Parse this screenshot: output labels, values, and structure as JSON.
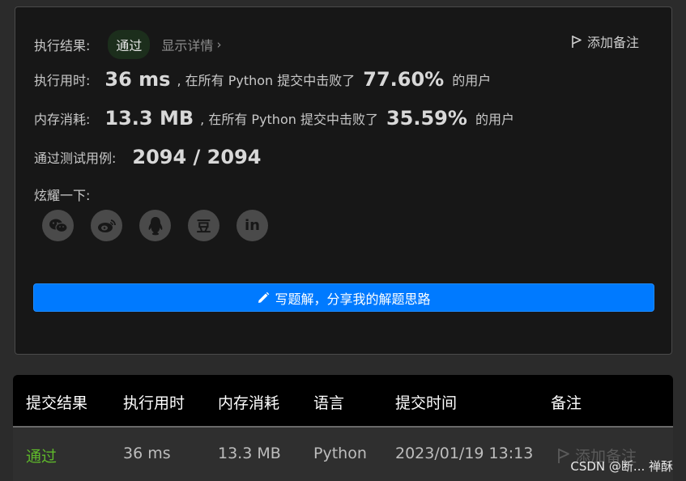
{
  "result": {
    "label": "执行结果:",
    "status": "通过",
    "details_link": "显示详情",
    "details_chevron": "›",
    "add_note": "添加备注"
  },
  "runtime": {
    "label": "执行用时:",
    "value": "36 ms",
    "middle": ", 在所有 Python 提交中击败了",
    "percent": "77.60%",
    "suffix": "的用户"
  },
  "memory": {
    "label": "内存消耗:",
    "value": "13.3 MB",
    "middle": ", 在所有 Python 提交中击败了",
    "percent": "35.59%",
    "suffix": "的用户"
  },
  "tests": {
    "label": "通过测试用例:",
    "value": "2094 / 2094"
  },
  "share": {
    "label": "炫耀一下:",
    "icons": [
      "wechat-icon",
      "weibo-icon",
      "qq-icon",
      "douban-icon",
      "linkedin-icon"
    ],
    "douban_glyph": "豆",
    "linkedin_glyph": "in"
  },
  "write_button": "写题解，分享我的解题思路",
  "table": {
    "headers": [
      "提交结果",
      "执行用时",
      "内存消耗",
      "语言",
      "提交时间",
      "备注"
    ],
    "row": {
      "result": "通过",
      "runtime": "36 ms",
      "memory": "13.3 MB",
      "language": "Python",
      "time": "2023/01/19 13:13",
      "note": "添加备注"
    }
  },
  "watermark": "CSDN @断... 禅酥",
  "colors": {
    "accent": "#007aff",
    "pass_green": "#5fb92b",
    "card_bg": "#171717"
  }
}
